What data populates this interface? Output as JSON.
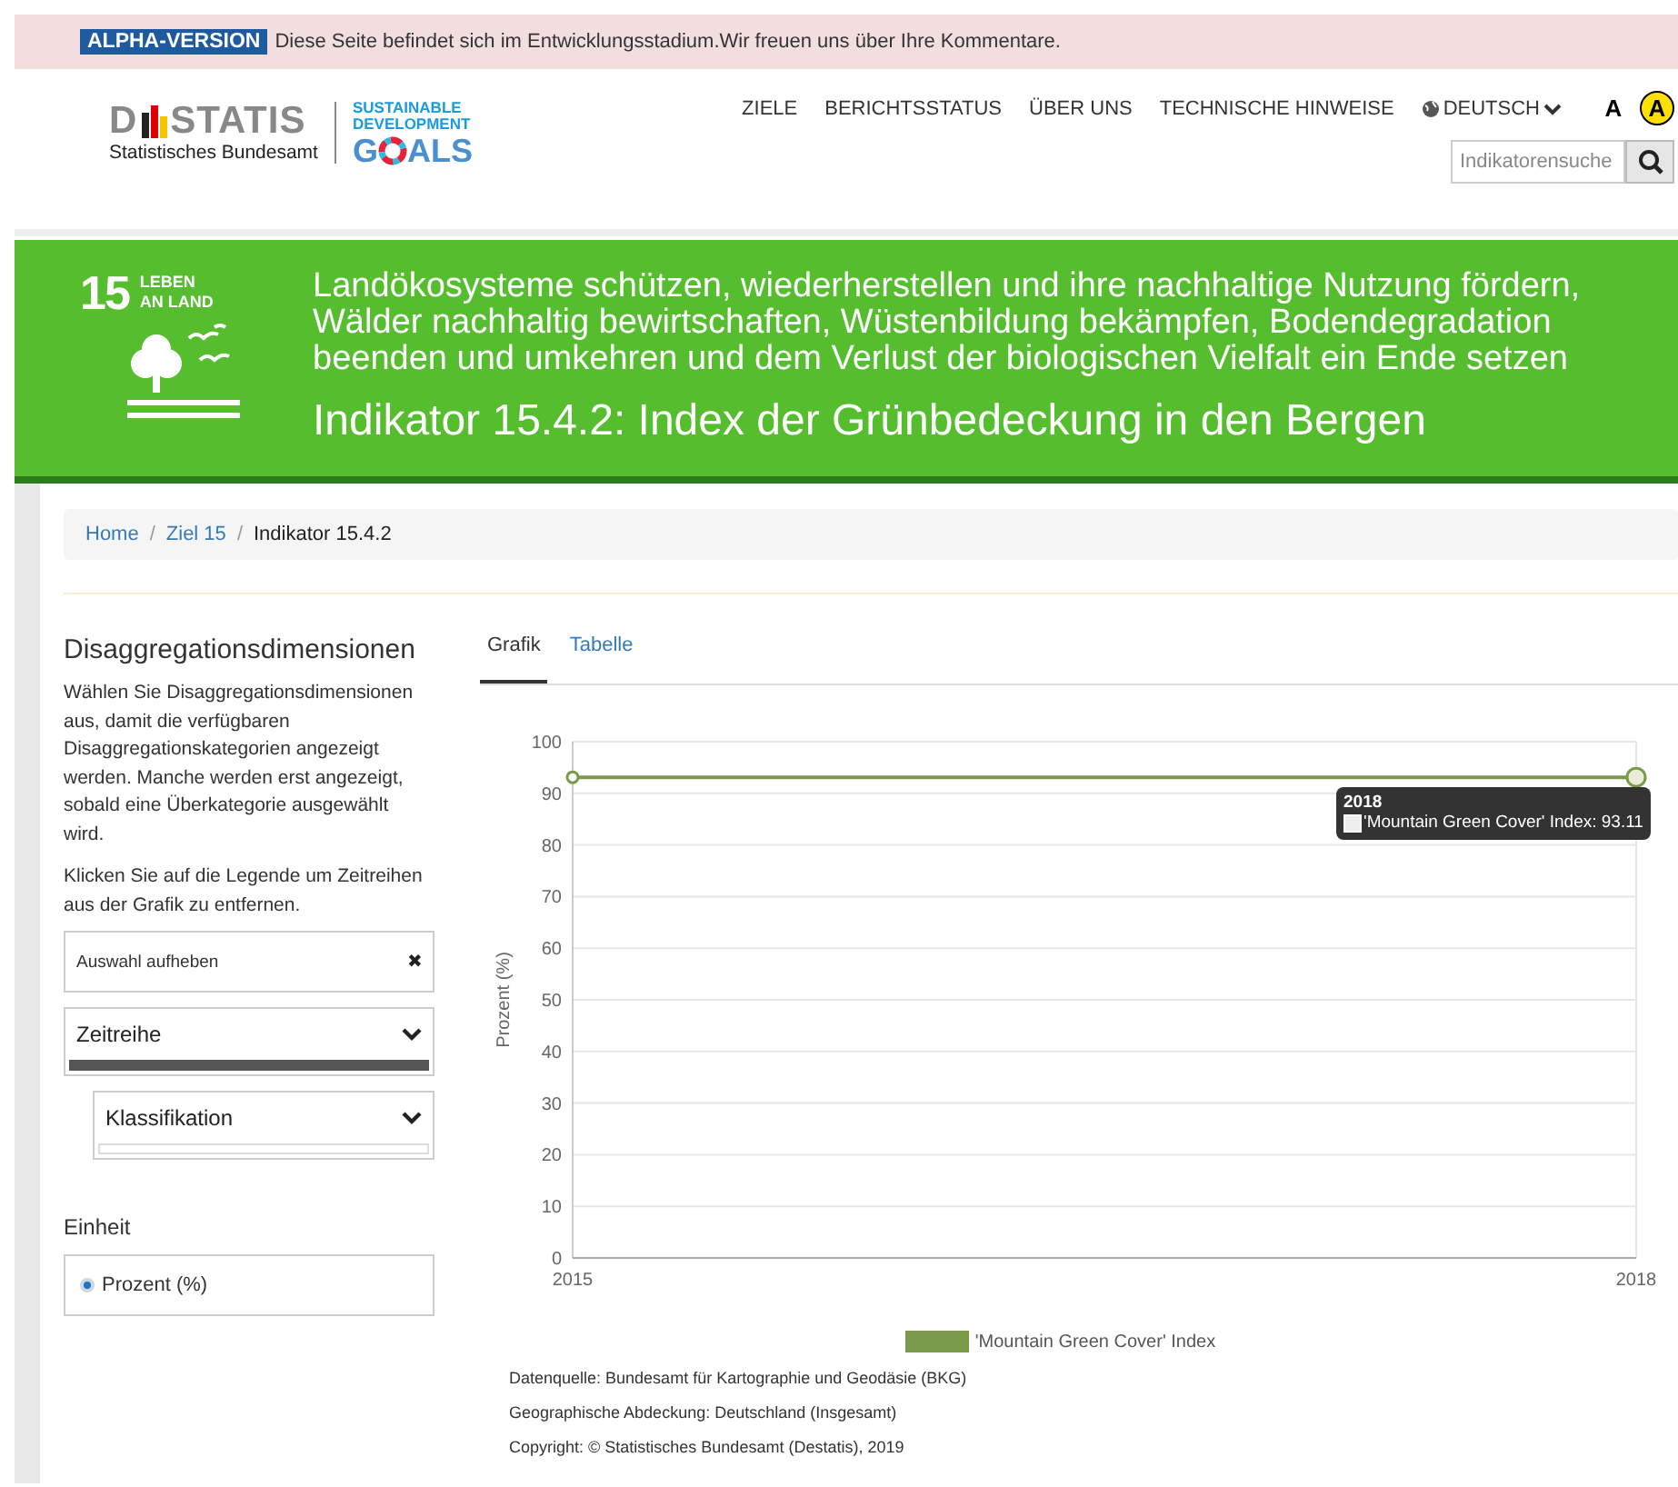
{
  "alert": {
    "badge": "ALPHA-VERSION",
    "message": "Diese Seite befindet sich im Entwicklungsstadium.Wir freuen uns über Ihre Kommentare."
  },
  "header": {
    "logo": {
      "letter": "D",
      "rest": "STATIS",
      "subtitle": "Statistisches Bundesamt",
      "sdg_line1": "SUSTAINABLE",
      "sdg_line2": "DEVELOPMENT",
      "sdg_g": "G",
      "sdg_rest": "ALS"
    },
    "nav": [
      {
        "label": "ZIELE"
      },
      {
        "label": "BERICHTSSTATUS"
      },
      {
        "label": "ÜBER UNS"
      },
      {
        "label": "TECHNISCHE HINWEISE"
      }
    ],
    "language": "DEUTSCH",
    "font_buttons": [
      {
        "label": "A",
        "kind": "plain"
      },
      {
        "label": "A",
        "kind": "contrast"
      }
    ],
    "search": {
      "placeholder": "Indikatorensuche"
    }
  },
  "banner": {
    "goal_number": "15",
    "goal_name_1": "LEBEN",
    "goal_name_2": "AN LAND",
    "goal_text": "Landökosysteme schützen, wiederherstellen und ihre nachhaltige Nutzung fördern, Wälder nachhaltig bewirtschaften, Wüstenbildung bekämpfen, Bodendegradation beenden und umkehren und dem Verlust der biologischen Vielfalt ein Ende setzen",
    "indicator": "Indikator 15.4.2: Index der Grünbedeckung in den Bergen"
  },
  "breadcrumb": [
    {
      "label": "Home",
      "current": false
    },
    {
      "separator": "/",
      "label": "Ziel 15",
      "current": false
    },
    {
      "separator": "/",
      "label": "Indikator 15.4.2",
      "current": true
    }
  ],
  "sidebar": {
    "title": "Disaggregationsdimensionen",
    "intro": "Wählen Sie Disaggregationsdimensionen aus, damit die verfügbaren Disaggregationskategorien angezeigt werden. Manche werden erst angezeigt, sobald eine Überkategorie ausgewählt wird.",
    "hint": "Klicken Sie auf die Legende um Zeitreihen aus der Grafik zu entfernen.",
    "clear": "Auswahl aufheben",
    "clear_icon": "✖",
    "dropdowns": [
      {
        "label": "Zeitreihe",
        "active": true,
        "nested": false
      },
      {
        "label": "Klassifikation",
        "active": false,
        "nested": true
      }
    ],
    "unit_title": "Einheit",
    "units": [
      {
        "label": "Prozent (%)",
        "selected": true
      }
    ]
  },
  "tabs": [
    {
      "label": "Grafik",
      "selected": true
    },
    {
      "label": "Tabelle",
      "selected": false
    }
  ],
  "chart": {
    "chart_data": {
      "type": "line",
      "ylabel": "Prozent (%)",
      "x": [
        2015,
        2018
      ],
      "series": [
        {
          "name": "'Mountain Green Cover' Index",
          "color": "#7a9a4a",
          "marker": true,
          "values": [
            93.11,
            93.11
          ]
        }
      ],
      "xlim": [
        2015,
        2018
      ],
      "grid": true,
      "ylim": [
        0,
        100
      ],
      "yticks": [
        0,
        10,
        20,
        30,
        40,
        50,
        60,
        70,
        80,
        90,
        100
      ],
      "xticks": [
        2015,
        2018
      ]
    },
    "tooltip": {
      "title": "2018",
      "text": "'Mountain Green Cover' Index: 93.11"
    }
  },
  "footnotes": [
    "Datenquelle: Bundesamt für Kartographie und Geodäsie (BKG)",
    "Geographische Abdeckung: Deutschland (Insgesamt)",
    "Copyright: © Statistisches Bundesamt (Destatis), 2019"
  ]
}
